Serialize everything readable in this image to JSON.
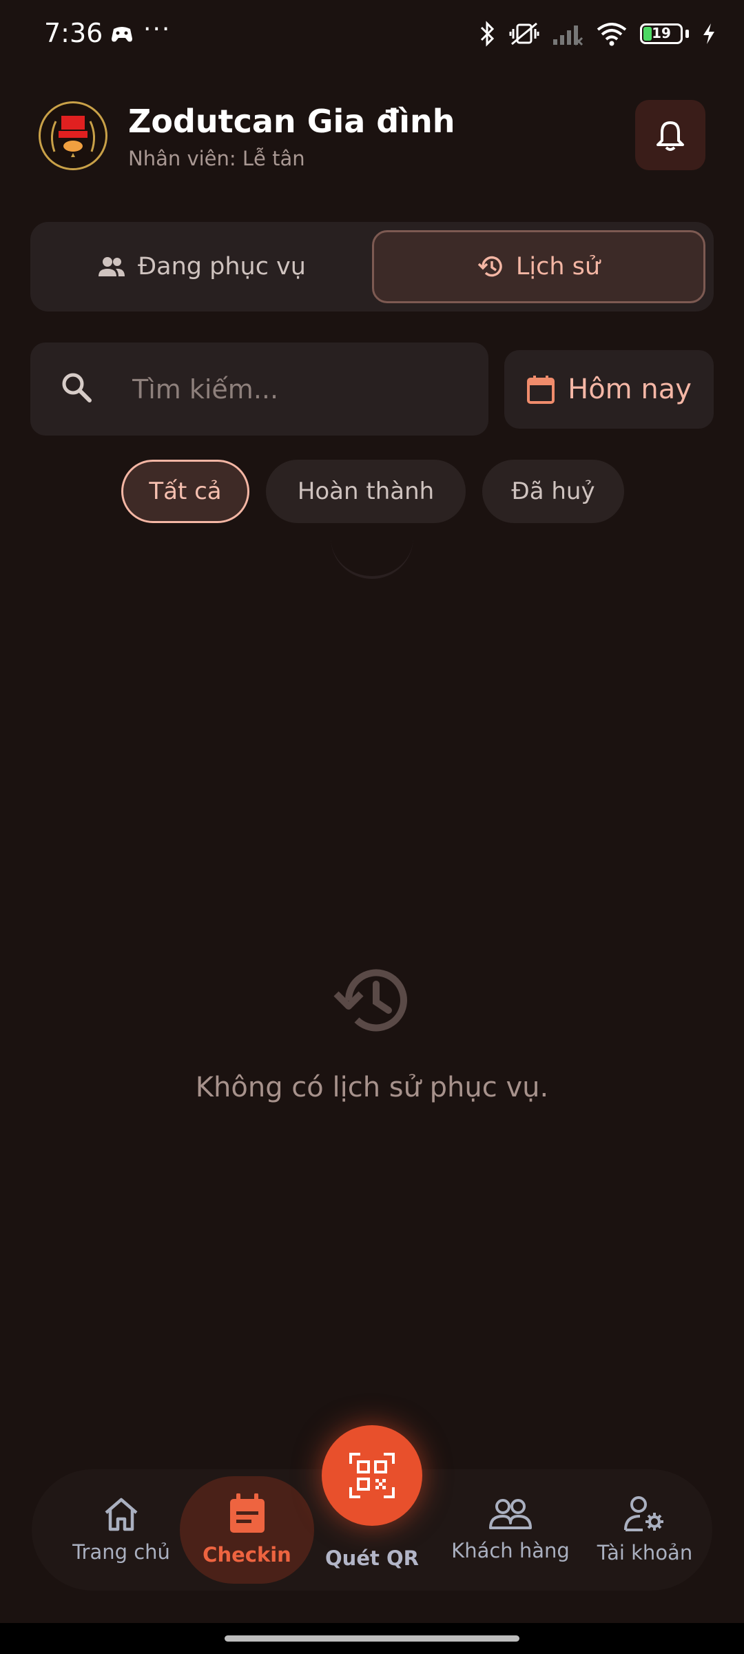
{
  "status_bar": {
    "time": "7:36",
    "battery": "19",
    "battery_level": 0.19
  },
  "header": {
    "title": "Zodutcan Gia đình",
    "subtitle": "Nhân viên: Lễ tân"
  },
  "tabs": [
    {
      "label": "Đang phục vụ",
      "icon": "people-icon",
      "active": false
    },
    {
      "label": "Lịch sử",
      "icon": "history-icon",
      "active": true
    }
  ],
  "search": {
    "placeholder": "Tìm kiếm...",
    "value": ""
  },
  "date_filter": {
    "label": "Hôm nay",
    "icon": "calendar-icon"
  },
  "filters": [
    {
      "label": "Tất cả",
      "active": true
    },
    {
      "label": "Hoàn thành",
      "active": false
    },
    {
      "label": "Đã huỷ",
      "active": false
    }
  ],
  "empty_state": {
    "message": "Không có lịch sử phục vụ.",
    "icon": "history-icon"
  },
  "bottom_nav": [
    {
      "label": "Trang chủ",
      "icon": "home-icon",
      "active": false
    },
    {
      "label": "Checkin",
      "icon": "checkin-icon",
      "active": true
    },
    {
      "label": "Quét QR",
      "icon": "qr-scan-icon",
      "active": false
    },
    {
      "label": "Khách hàng",
      "icon": "customers-icon",
      "active": false
    },
    {
      "label": "Tài khoản",
      "icon": "account-settings-icon",
      "active": false
    }
  ],
  "colors": {
    "accent": "#e8502c",
    "accent_soft": "#f4b6a4",
    "background": "#1b1210"
  }
}
